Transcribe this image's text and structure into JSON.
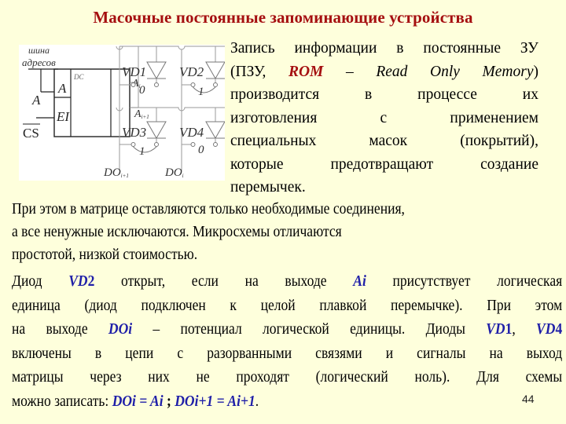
{
  "slide": {
    "title": "Масочные постоянные запоминающие устройства",
    "page_number": "44",
    "colors": {
      "background": "#FEFFDC",
      "title": "#A50F10",
      "highlight": "#1F1FA8",
      "rom_highlight": "#A50F10"
    }
  },
  "diagram": {
    "bus_label_1": "шина",
    "bus_label_2": "адресов",
    "input_a": "A",
    "input_cs": "CS",
    "block_a": "A",
    "block_ei": "EI",
    "block_dc": "DC",
    "row_ai": "A",
    "row_ai_sub": "i",
    "row_ai1": "A",
    "row_ai1_sub": "i+1",
    "vd1": "VD1",
    "vd2": "VD2",
    "vd3": "VD3",
    "vd4": "VD4",
    "vd1_bit": "0",
    "vd2_bit": "1",
    "vd3_bit": "1",
    "vd4_bit": "0",
    "col_do_i1": "DO",
    "col_do_i1_sub": "i+1",
    "col_do_i": "DO",
    "col_do_i_sub": "i"
  },
  "right_text": {
    "l1": "Запись информации в постоянные ЗУ",
    "l2_a": "(ПЗУ, ",
    "l2_rom": "ROM",
    "l2_b": " – ",
    "l2_c": "Read Only Memory",
    "l2_d": ")",
    "l3": "производится в процессе их",
    "l4": "изготовления с применением",
    "l5": "специальных масок (покрытий),",
    "l6": "которые предотвращают создание",
    "l7": "перемычек."
  },
  "paragraph1": {
    "l1": "При этом в матрице оставляются только необходимые соединения,",
    "l2": "а все ненужные исключаются. Микросхемы отличаются",
    "l3": "простотой, низкой стоимостью."
  },
  "paragraph2": {
    "l1_a": "Диод ",
    "l1_vd2": "VD",
    "l1_vd2_n": "2",
    "l1_b": " открыт, если на выходе ",
    "l1_ai": "Ai",
    "l1_c": " присутствует логическая",
    "l2": "единица (диод подключен к целой плавкой перемычке). При этом",
    "l3_a": "на выходе ",
    "l3_doi": "DOi",
    "l3_b": " – потенциал логической единицы. Диоды ",
    "l3_vd1": "VD",
    "l3_vd1_n": "1",
    "l3_c": ", ",
    "l3_vd4": "VD",
    "l3_vd4_n": "4",
    "l4": "включены в цепи с разорванными связями и сигналы на выход",
    "l5": "матрицы через них не проходят (логический ноль). Для схемы",
    "l6_a": "можно записать: ",
    "l6_eq1": "DOi = Ai",
    "l6_b": " ; ",
    "l6_eq2": "DOi+1 = Ai+1",
    "l6_c": "."
  }
}
